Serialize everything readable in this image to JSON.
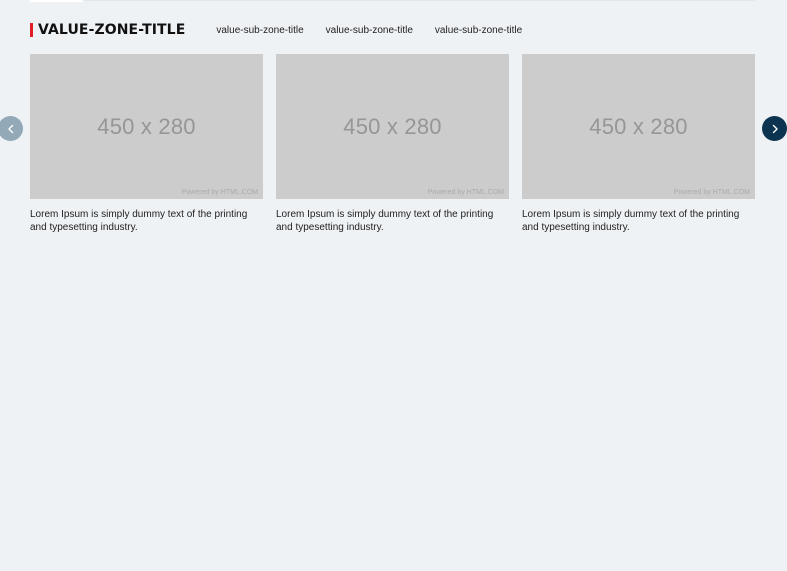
{
  "zone": {
    "title": "VALUE-ZONE-TITLE",
    "accent_color": "#e31e24",
    "sub_titles": [
      "value-sub-zone-title",
      "value-sub-zone-title",
      "value-sub-zone-title"
    ]
  },
  "carousel": {
    "prev_icon": "chevron-left-icon",
    "next_icon": "chevron-right-icon",
    "prev_color": "#94a9b8",
    "next_color": "#0c3350",
    "cards": [
      {
        "image_label": "450 x 280",
        "image_credit": "Powered by HTML.COM",
        "caption": "Lorem Ipsum is simply dummy text of the printing and typesetting industry."
      },
      {
        "image_label": "450 x 280",
        "image_credit": "Powered by HTML.COM",
        "caption": "Lorem Ipsum is simply dummy text of the printing and typesetting industry."
      },
      {
        "image_label": "450 x 280",
        "image_credit": "Powered by HTML.COM",
        "caption": "Lorem Ipsum is simply dummy text of the printing and typesetting industry."
      }
    ]
  }
}
